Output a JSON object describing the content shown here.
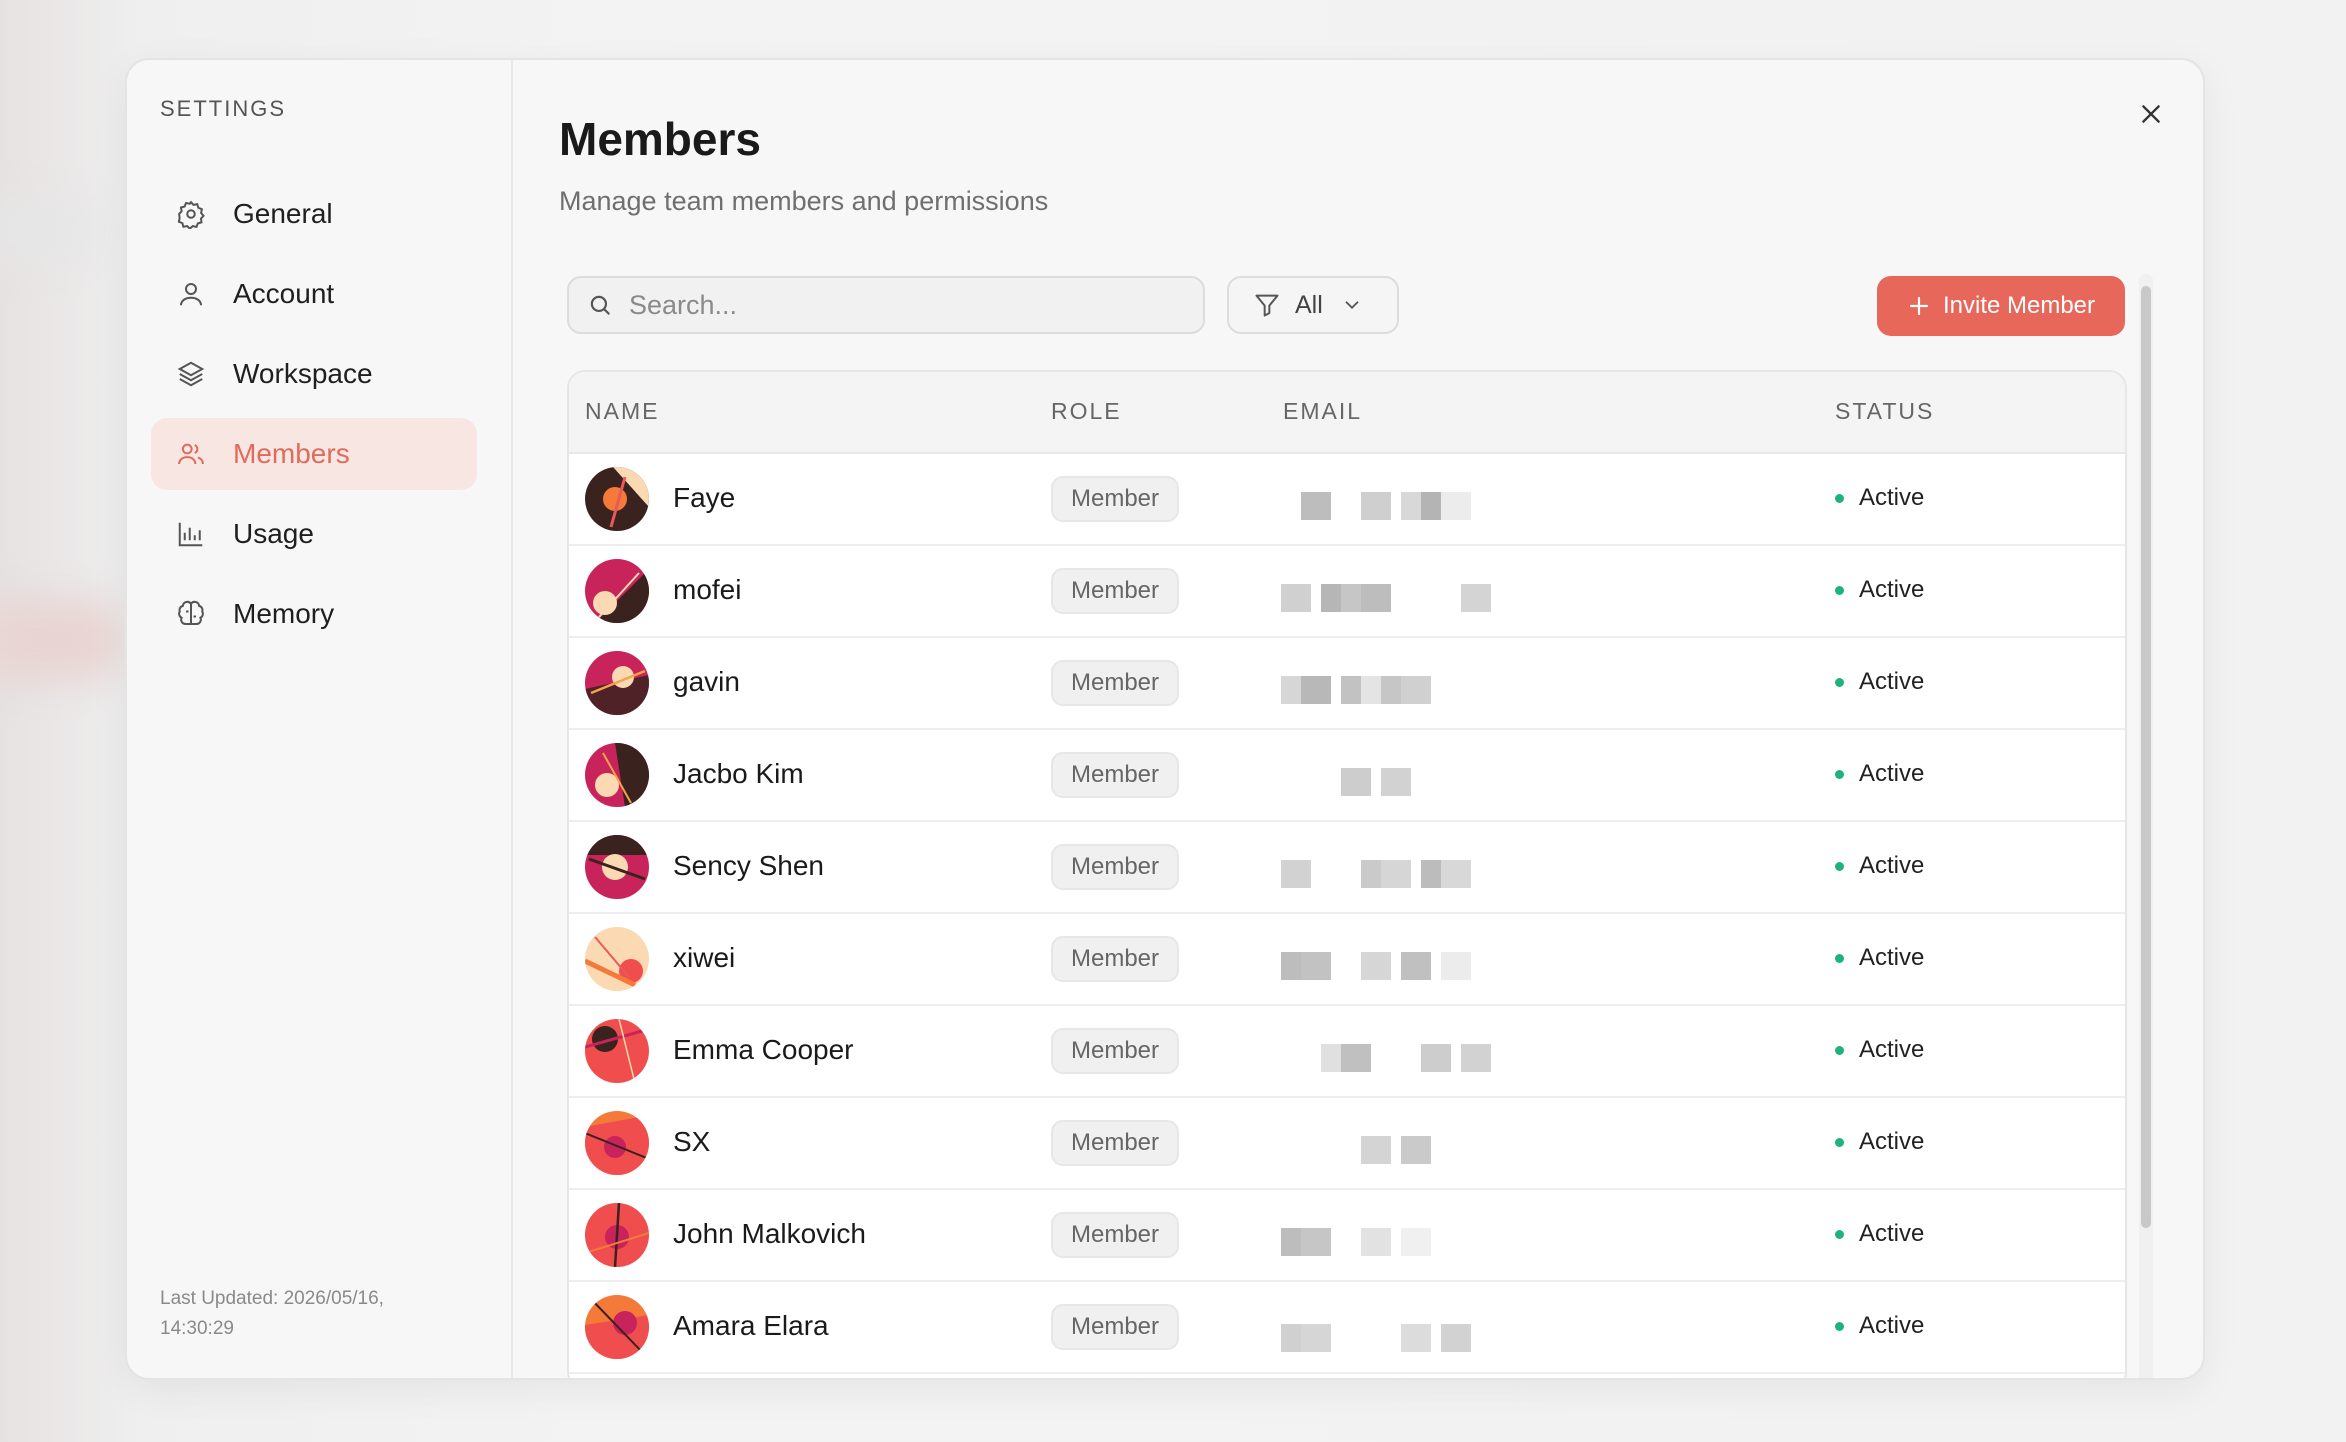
{
  "sidebar": {
    "title": "SETTINGS",
    "items": [
      {
        "label": "General",
        "icon": "gear-icon"
      },
      {
        "label": "Account",
        "icon": "user-icon"
      },
      {
        "label": "Workspace",
        "icon": "layers-icon"
      },
      {
        "label": "Members",
        "icon": "users-icon",
        "active": true
      },
      {
        "label": "Usage",
        "icon": "bar-chart-icon"
      },
      {
        "label": "Memory",
        "icon": "brain-icon"
      }
    ],
    "last_updated": "Last Updated: 2026/05/16, 14:30:29"
  },
  "main": {
    "title": "Members",
    "subtitle": "Manage team members and permissions",
    "search_placeholder": "Search...",
    "filter_label": "All",
    "invite_label": "Invite Member"
  },
  "table": {
    "headers": {
      "name": "NAME",
      "role": "ROLE",
      "email": "EMAIL",
      "status": "STATUS"
    },
    "rows": [
      {
        "name": "Faye",
        "role": "Member",
        "status": "Active"
      },
      {
        "name": "mofei",
        "role": "Member",
        "status": "Active"
      },
      {
        "name": "gavin",
        "role": "Member",
        "status": "Active"
      },
      {
        "name": "Jacbo Kim",
        "role": "Member",
        "status": "Active"
      },
      {
        "name": "Sency Shen",
        "role": "Member",
        "status": "Active"
      },
      {
        "name": "xiwei",
        "role": "Member",
        "status": "Active"
      },
      {
        "name": "Emma Cooper",
        "role": "Member",
        "status": "Active"
      },
      {
        "name": "SX",
        "role": "Member",
        "status": "Active"
      },
      {
        "name": "John Malkovich",
        "role": "Member",
        "status": "Active"
      },
      {
        "name": "Amara Elara",
        "role": "Member",
        "status": "Active"
      }
    ]
  },
  "colors": {
    "accent": "#e7675a",
    "active_nav_bg": "#f8e6e3",
    "status_active": "#1db37a"
  }
}
